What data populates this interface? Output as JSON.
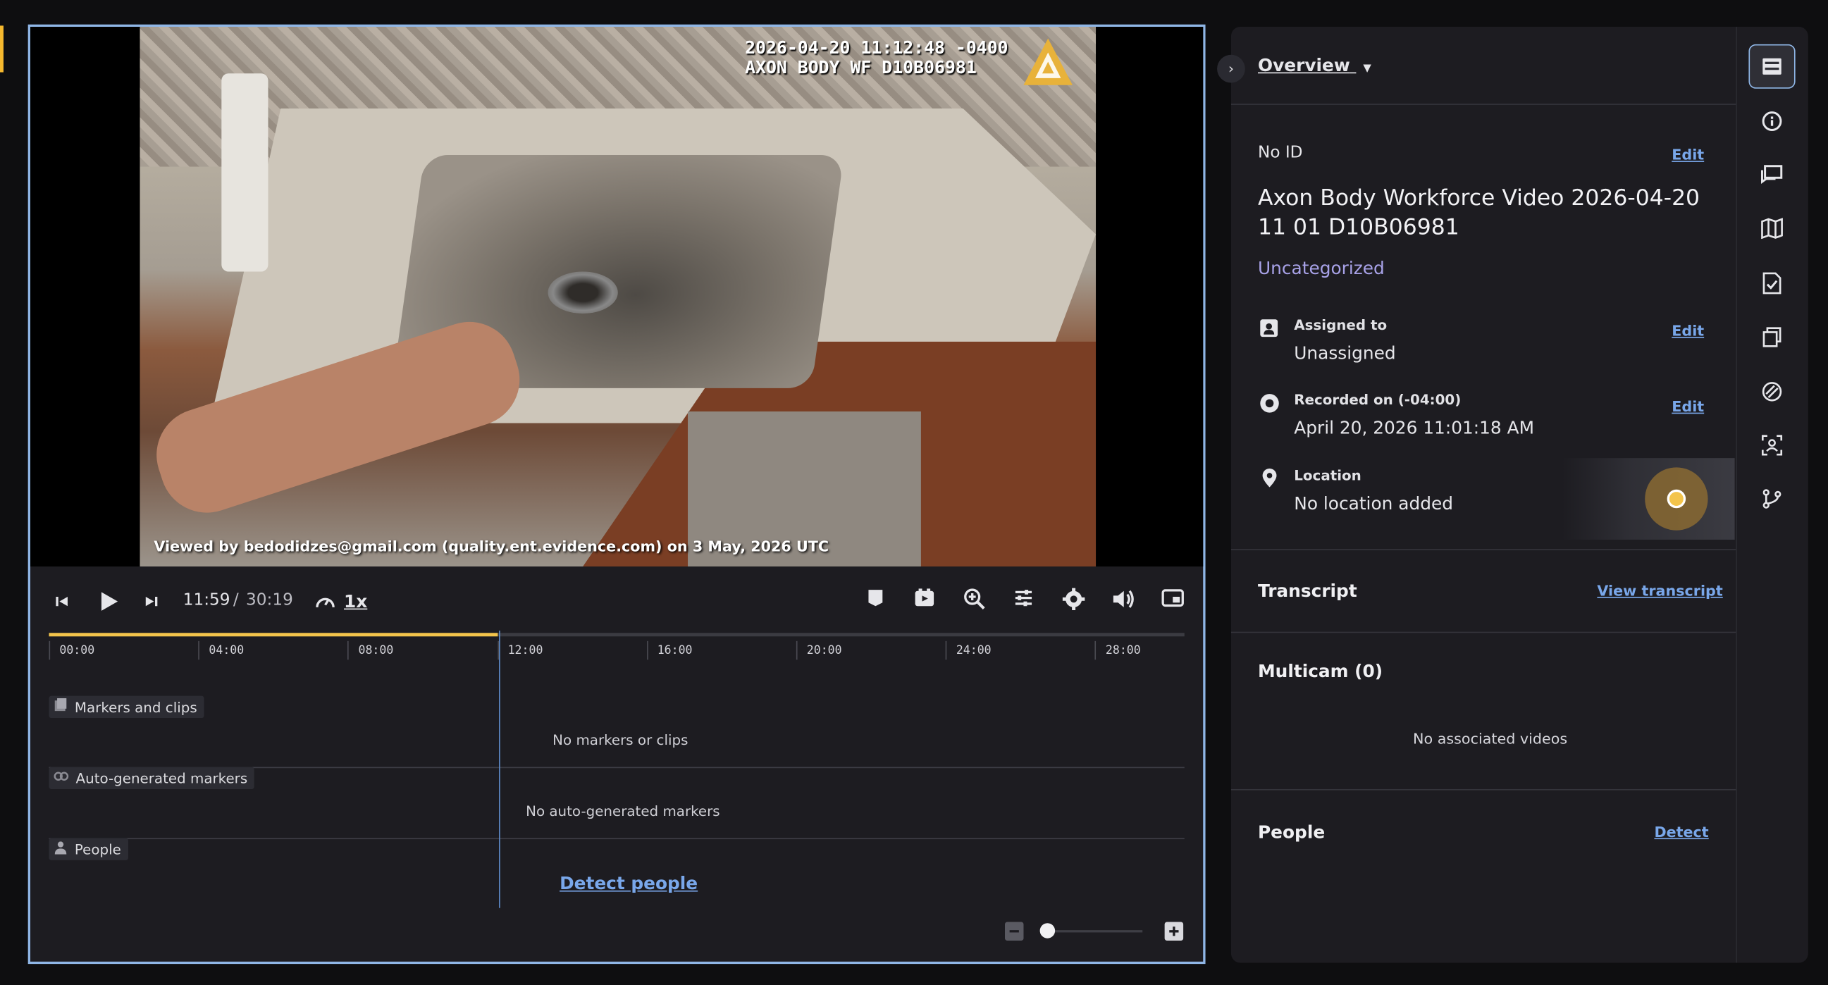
{
  "video": {
    "osd_line1": "2026-04-20 11:12:48 -0400",
    "osd_line2": "AXON BODY WF D10B06981",
    "watermark": "Viewed by bedodidzes@gmail.com (quality.ent.evidence.com) on 3 May, 2026 UTC"
  },
  "controls": {
    "current_time": "11:59",
    "separator": "/",
    "total_time": "30:19",
    "speed": "1x",
    "progress_fraction": 0.395
  },
  "timeline": {
    "ticks": [
      "00:00",
      "04:00",
      "08:00",
      "12:00",
      "16:00",
      "20:00",
      "24:00",
      "28:00"
    ],
    "tracks": [
      {
        "label": "Markers and clips",
        "empty": "No markers or clips"
      },
      {
        "label": "Auto-generated markers",
        "empty": "No auto-generated markers"
      },
      {
        "label": "People",
        "action": "Detect people"
      }
    ]
  },
  "panel": {
    "header": "Overview",
    "id_label": "No ID",
    "edit": "Edit",
    "title": "Axon Body Workforce Video 2026-04-20 11 01 D10B06981",
    "category": "Uncategorized",
    "assigned_label": "Assigned to",
    "assigned_value": "Unassigned",
    "recorded_label": "Recorded on (-04:00)",
    "recorded_value": "April 20, 2026 11:01:18 AM",
    "location_label": "Location",
    "location_value": "No location added",
    "transcript_title": "Transcript",
    "transcript_link": "View transcript",
    "multicam_title": "Multicam (0)",
    "multicam_empty": "No associated videos",
    "people_title": "People",
    "people_link": "Detect"
  },
  "colors": {
    "accent": "#f5b82e",
    "link": "#79a7ea",
    "category": "#a8a2e8",
    "focus_border": "#8fb6e6"
  },
  "rail_icons": [
    "overview-icon",
    "info-icon",
    "comments-icon",
    "map-icon",
    "audit-icon",
    "copies-icon",
    "redaction-icon",
    "face-detect-icon",
    "branch-icon"
  ]
}
